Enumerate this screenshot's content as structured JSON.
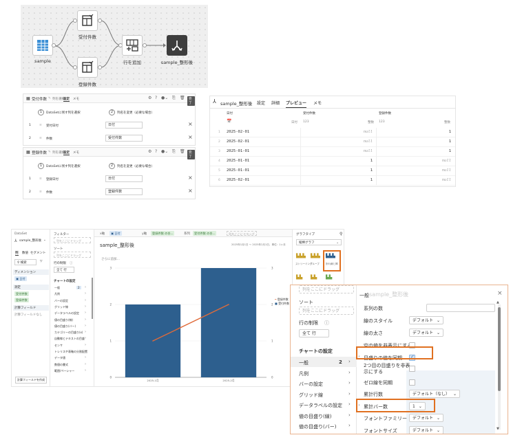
{
  "flow": {
    "nodes": {
      "sample": "sample",
      "uketsuke": "受付件数",
      "toroku": "登録件数",
      "add_row": "行を追加",
      "output": "sample_整形後"
    }
  },
  "step1": {
    "title": "受付件数",
    "tabs": [
      "列を選択",
      "設定",
      "メモ"
    ],
    "done": "完了",
    "step_a": "1",
    "step_a_label": "DataSetに残す列を選択",
    "step_b": "2",
    "step_b_label": "列名を変更（必要な場合）",
    "rows": [
      {
        "no": "1",
        "src": "受付日付",
        "dst": "日付"
      },
      {
        "no": "2",
        "src": "件数",
        "dst": "受付件数"
      }
    ]
  },
  "step2": {
    "title": "登録件数",
    "tabs": [
      "列を選択",
      "設定",
      "メモ"
    ],
    "done": "完了",
    "step_a": "1",
    "step_a_label": "DataSetに残す列を選択",
    "step_b": "2",
    "step_b_label": "列名を変更（必要な場合）",
    "rows": [
      {
        "no": "1",
        "src": "登録日付",
        "dst": "日付"
      },
      {
        "no": "2",
        "src": "件数",
        "dst": "登録件数"
      }
    ]
  },
  "preview": {
    "title": "sample_整形後",
    "tabs": [
      "設定",
      "詳細",
      "プレビュー",
      "メモ"
    ],
    "headers": [
      "日付",
      "受付件数",
      "登録件数"
    ],
    "types": [
      "日付",
      "123",
      "整数",
      "123",
      "整数"
    ],
    "rows": [
      {
        "n": "1",
        "d": "2025-02-01",
        "a": "null",
        "b": "1"
      },
      {
        "n": "2",
        "d": "2025-02-01",
        "a": "null",
        "b": "1"
      },
      {
        "n": "3",
        "d": "2025-01-01",
        "a": "null",
        "b": "1"
      },
      {
        "n": "4",
        "d": "2025-01-01",
        "a": "1",
        "b": "null"
      },
      {
        "n": "5",
        "d": "2025-01-01",
        "a": "1",
        "b": "null"
      },
      {
        "n": "6",
        "d": "2025-02-01",
        "a": "1",
        "b": "null"
      }
    ]
  },
  "editor": {
    "dataset_label": "DataSet",
    "dataset_name": "sample_整形後",
    "tabs": [
      "列",
      "数値",
      "セグメント"
    ],
    "search": "検索",
    "dimension": "ディメンション",
    "dim_item": "日付",
    "measure": "測定",
    "meas_items": [
      "受付件数",
      "登録件数"
    ],
    "calc": "計算フィールド",
    "calc_empty": "計算フィールドなし",
    "calc_btn": "計算フィールドを作成",
    "filter": "フィルター",
    "drop_here": "列をここにドラッグ",
    "sort": "ソート",
    "row_limit": "行の制限",
    "all_rows": "全て 行",
    "chart_settings": "チャートの設定",
    "settings_items": [
      "一般",
      "凡例",
      "バーの設定",
      "グリッド線",
      "データラベルの設定",
      "値の目盛り(線)",
      "値の目盛り(バー)",
      "カテゴリーの目盛り(x)",
      "自動線とテキストの目盛",
      "センサ",
      "トレリスや表軸の分割配置",
      "データ値",
      "数値の書式",
      "範囲/ペーシャー"
    ],
    "general_count": "2",
    "chips": {
      "x": "日付",
      "y1": "登録件数 の合...",
      "y2": "受付件数 の合..."
    },
    "chart_title": "sample_整形後",
    "date_range": "2025年1月1日 ～ 2025年2月1日、単位：1ヶ月",
    "add_more": "さらに追加…",
    "chart_type_label": "グラフタイプ",
    "chart_type_value": "縦棒グラフ",
    "thumb_labels": [
      "ストリーミング",
      "グループ",
      "折れ線と棒"
    ],
    "legend": [
      "登録件数",
      "受付件数"
    ]
  },
  "chart_data": {
    "type": "bar",
    "categories": [
      "2025-1月",
      "2025-2月"
    ],
    "series": [
      {
        "name": "受付件数",
        "kind": "line",
        "values": [
          1,
          2
        ]
      },
      {
        "name": "登録件数",
        "kind": "bar",
        "values": [
          2,
          3
        ]
      }
    ],
    "y_left_ticks": [
      "0",
      "1",
      "2",
      "3"
    ],
    "y_right_ticks": [
      "0",
      "1",
      "2",
      "3"
    ],
    "ylim": [
      0,
      3
    ],
    "colors": {
      "bar": "#2d5f8e",
      "line": "#e06b3a"
    }
  },
  "zoom": {
    "drop1": "列をここにドラッグ",
    "sort": "ソート",
    "drop2": "列をここにドラッグ",
    "row_limit": "行の制限",
    "all_rows": "全て 行",
    "chart_settings": "チャートの設定",
    "menu": [
      {
        "label": "一般",
        "count": "2"
      },
      {
        "label": "凡例"
      },
      {
        "label": "バーの設定"
      },
      {
        "label": "グリッド線"
      },
      {
        "label": "データラベルの設定"
      },
      {
        "label": "値の目盛り(線)"
      },
      {
        "label": "値の目盛り(バー)"
      },
      {
        "label": "カテゴリーの目盛り(x)"
      }
    ],
    "right_title": "一般",
    "right_title_faded": "sample_整形後",
    "settings": [
      {
        "label": "系列の数",
        "control": "input"
      },
      {
        "label": "線のスタイル",
        "control": "drop",
        "value": "デフォルト"
      },
      {
        "label": "線の太さ",
        "control": "drop",
        "value": "デフォルト"
      },
      {
        "label": "空の値を非表示にする",
        "control": "check"
      },
      {
        "label": "目盛りの値を同期",
        "control": "checked"
      },
      {
        "label": "2つ目の目盛りを非表示にする",
        "control": "check"
      },
      {
        "label": "ゼロ線を同期",
        "control": "check"
      },
      {
        "label": "累計行数",
        "control": "drop",
        "value": "デフォルト（なし）"
      },
      {
        "label": "累計バー数",
        "control": "drop",
        "value": "1"
      },
      {
        "label": "フォントファミリー",
        "control": "drop",
        "value": "デフォルト"
      },
      {
        "label": "フォントサイズ",
        "control": "drop",
        "value": "デフォルト"
      }
    ]
  }
}
